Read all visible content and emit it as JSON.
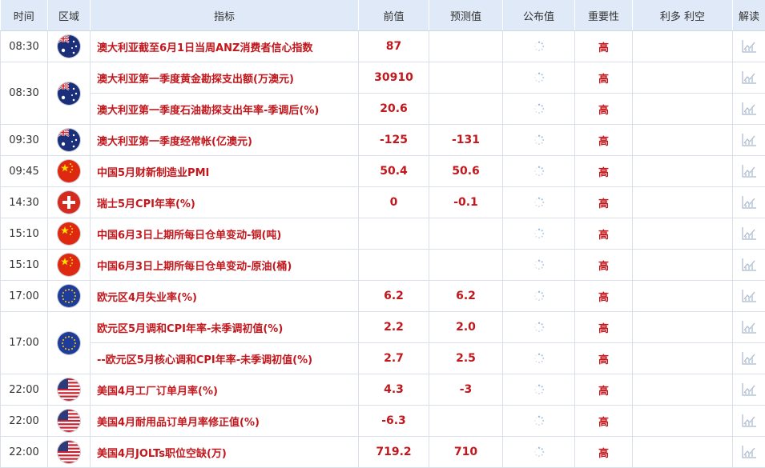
{
  "headers": {
    "time": "时间",
    "region": "区域",
    "indicator": "指标",
    "previous": "前值",
    "forecast": "预测值",
    "actual": "公布值",
    "importance": "重要性",
    "impact": "利多 利空",
    "analysis": "解读"
  },
  "rows": [
    {
      "time": "08:30",
      "flag": "australia-flag",
      "indicator": "澳大利亚截至6月1日当周ANZ消费者信心指数",
      "previous": "87",
      "forecast": "",
      "importance": "高"
    },
    {
      "time": "08:30",
      "flag": "australia-flag",
      "indicator": "澳大利亚第一季度黄金勘探支出额(万澳元)",
      "previous": "30910",
      "forecast": "",
      "importance": "高"
    },
    {
      "time": "",
      "flag": "",
      "indicator": "澳大利亚第一季度石油勘探支出年率-季调后(%)",
      "previous": "20.6",
      "forecast": "",
      "importance": "高"
    },
    {
      "time": "09:30",
      "flag": "australia-flag",
      "indicator": "澳大利亚第一季度经常帐(亿澳元)",
      "previous": "-125",
      "forecast": "-131",
      "importance": "高"
    },
    {
      "time": "09:45",
      "flag": "china-flag",
      "indicator": "中国5月财新制造业PMI",
      "previous": "50.4",
      "forecast": "50.6",
      "importance": "高"
    },
    {
      "time": "14:30",
      "flag": "switzerland-flag",
      "indicator": "瑞士5月CPI年率(%)",
      "previous": "0",
      "forecast": "-0.1",
      "importance": "高"
    },
    {
      "time": "15:10",
      "flag": "china-flag",
      "indicator": "中国6月3日上期所每日仓单变动-铜(吨)",
      "previous": "",
      "forecast": "",
      "importance": "高"
    },
    {
      "time": "15:10",
      "flag": "china-flag",
      "indicator": "中国6月3日上期所每日仓单变动-原油(桶)",
      "previous": "",
      "forecast": "",
      "importance": "高"
    },
    {
      "time": "17:00",
      "flag": "eu-flag",
      "indicator": "欧元区4月失业率(%)",
      "previous": "6.2",
      "forecast": "6.2",
      "importance": "高"
    },
    {
      "time": "17:00",
      "flag": "eu-flag",
      "indicator": "欧元区5月调和CPI年率-未季调初值(%)",
      "previous": "2.2",
      "forecast": "2.0",
      "importance": "高"
    },
    {
      "time": "",
      "flag": "",
      "indicator": "--欧元区5月核心调和CPI年率-未季调初值(%)",
      "previous": "2.7",
      "forecast": "2.5",
      "importance": "高"
    },
    {
      "time": "22:00",
      "flag": "usa-flag",
      "indicator": "美国4月工厂订单月率(%)",
      "previous": "4.3",
      "forecast": "-3",
      "importance": "高"
    },
    {
      "time": "22:00",
      "flag": "usa-flag",
      "indicator": "美国4月耐用品订单月率修正值(%)",
      "previous": "-6.3",
      "forecast": "",
      "importance": "高"
    },
    {
      "time": "22:00",
      "flag": "usa-flag",
      "indicator": "美国4月JOLTs职位空缺(万)",
      "previous": "719.2",
      "forecast": "710",
      "importance": "高"
    }
  ],
  "colors": {
    "header_bg": "#dfe9f7",
    "value_red": "#c2171c",
    "border": "#d9e0ea"
  }
}
